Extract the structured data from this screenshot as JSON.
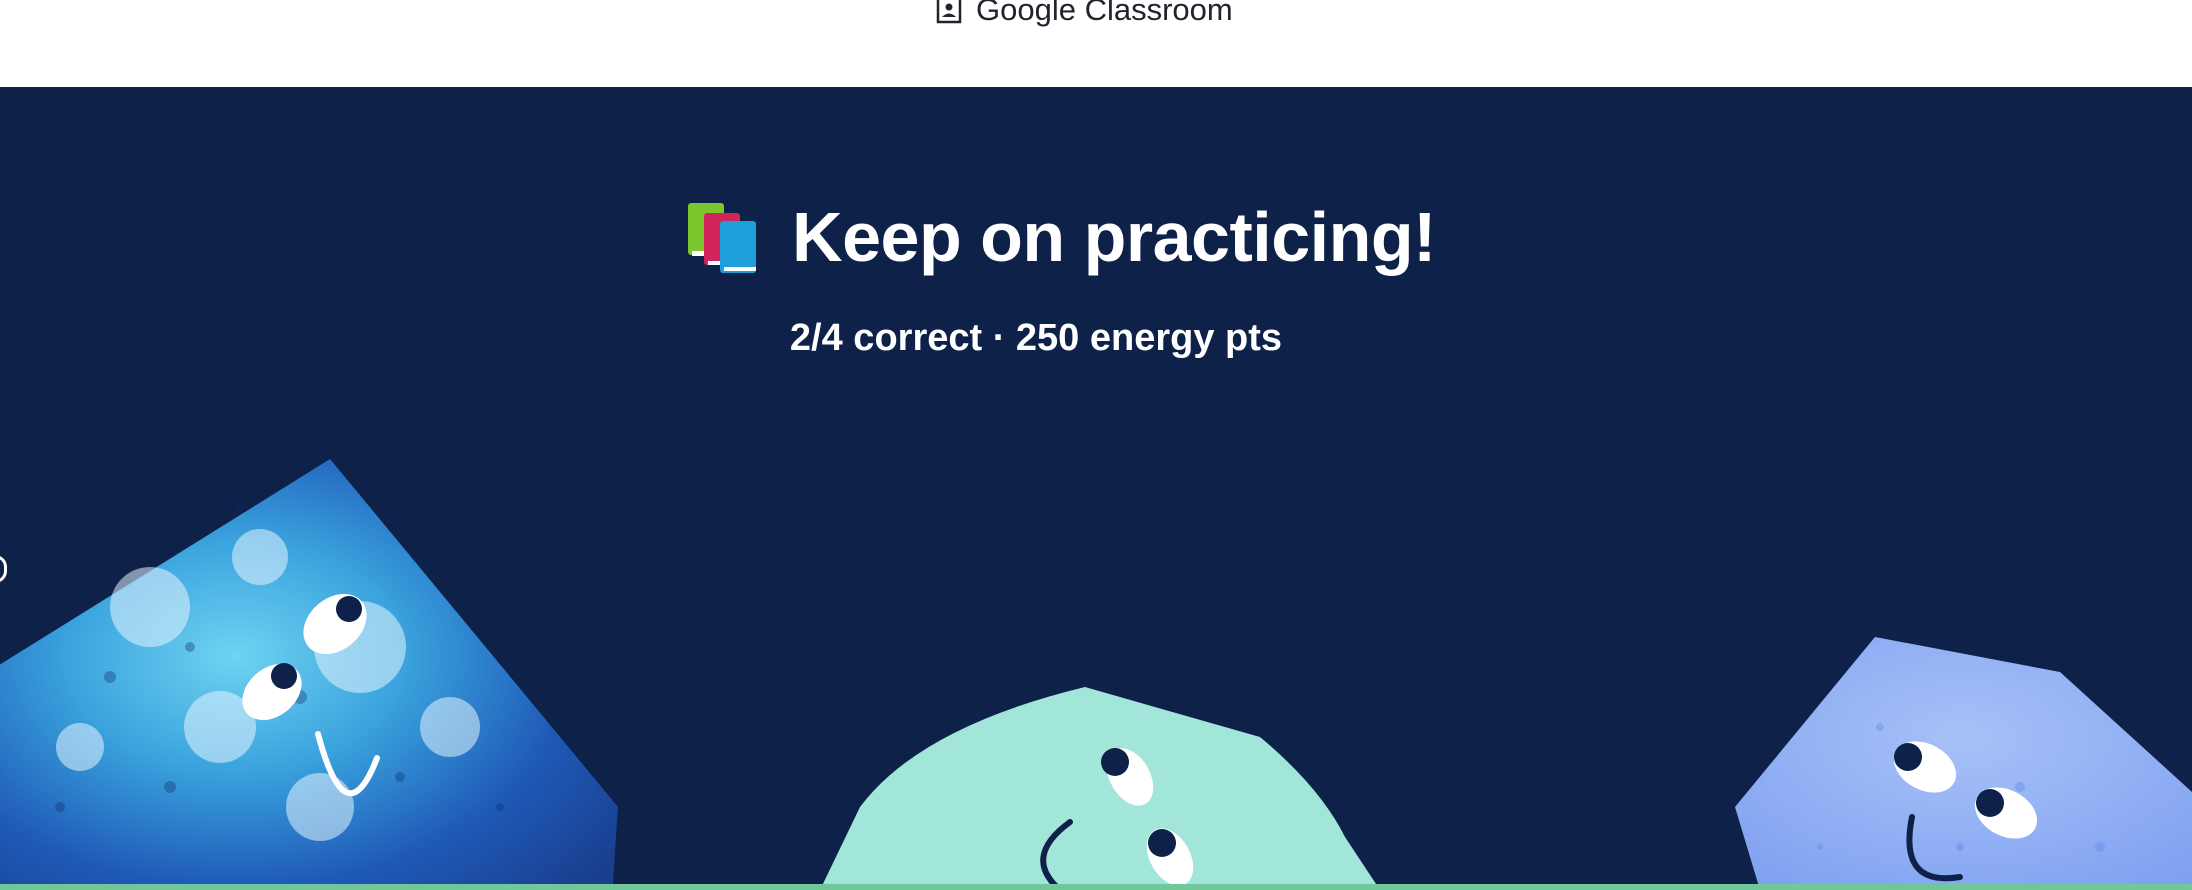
{
  "topbar": {
    "share_label": "Google Classroom",
    "share_icon": "classroom-icon"
  },
  "result": {
    "title": "Keep on practicing!",
    "title_icon": "books-emoji-icon",
    "score": "2/4 correct · 250 energy pts"
  },
  "colors": {
    "stage_background": "#0d2149",
    "title_text": "#ffffff",
    "bottom_strip": "#70c89a",
    "creature_left": "#2a68c0",
    "creature_middle": "#a1e6d9",
    "creature_right": "#8fb0f3"
  }
}
